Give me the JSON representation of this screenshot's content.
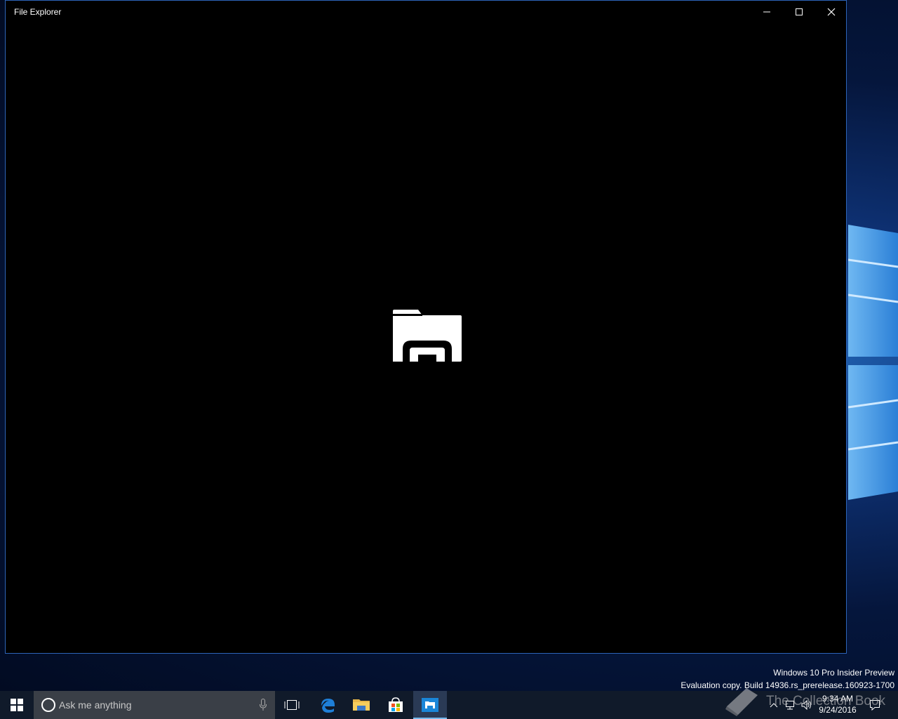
{
  "window": {
    "title": "File Explorer",
    "minimize_icon": "minimize-icon",
    "maximize_icon": "maximize-icon",
    "close_icon": "close-icon",
    "splash_icon": "file-explorer-icon",
    "border_color": "#2d64b8"
  },
  "watermark": {
    "line1": "Windows 10 Pro Insider Preview",
    "line2": "Evaluation copy. Build 14936.rs_prerelease.160923-1700"
  },
  "taskbar": {
    "start_icon": "windows-start-icon",
    "search_placeholder": "Ask me anything",
    "task_view_icon": "task-view-icon",
    "pinned": [
      {
        "name": "edge",
        "icon": "edge-icon"
      },
      {
        "name": "file-explorer",
        "icon": "folder-icon"
      },
      {
        "name": "store",
        "icon": "store-icon"
      },
      {
        "name": "file-explorer-running",
        "icon": "file-explorer-app-icon",
        "active": true
      }
    ],
    "accent_color": "#76b9ed",
    "clock": {
      "time": "9:34 AM",
      "date": "9/24/2016"
    }
  },
  "brand_overlay": {
    "text": "The Collection Book"
  }
}
